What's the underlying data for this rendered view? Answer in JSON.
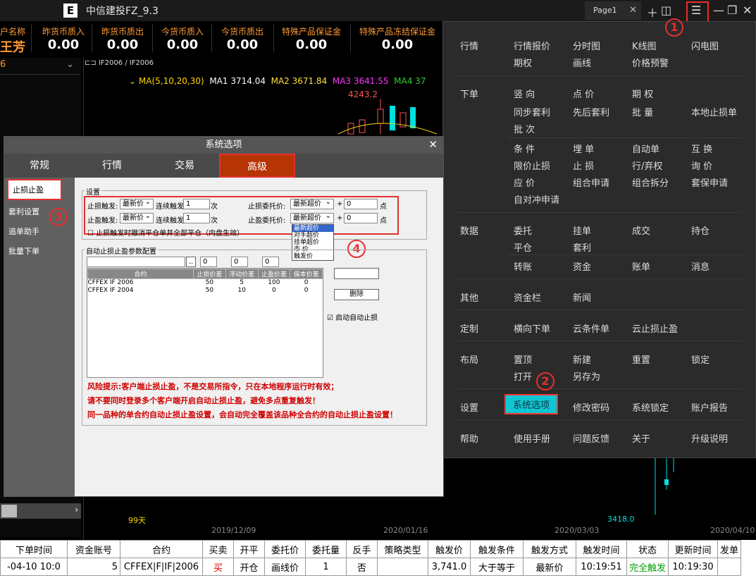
{
  "app": {
    "title": "中信建投FZ_9.3",
    "logo": "E",
    "page_tab": "Page1"
  },
  "titlebar_icons": [
    "add-icon",
    "layout-icon",
    "menu-icon",
    "minimize-icon",
    "restore-icon",
    "close-icon"
  ],
  "account_bar": {
    "columns": [
      {
        "label": "户名称",
        "value": "王芳"
      },
      {
        "label": "昨货币质入",
        "value": "0.00"
      },
      {
        "label": "昨货币质出",
        "value": "0.00"
      },
      {
        "label": "今货币质入",
        "value": "0.00"
      },
      {
        "label": "今货币质出",
        "value": "0.00"
      },
      {
        "label": "特殊产品保证金",
        "value": "0.00"
      },
      {
        "label": "特殊产品冻结保证金",
        "value": "0.00"
      }
    ]
  },
  "left_select": "6",
  "chart": {
    "contract_label": "IF2006 / IF2006",
    "ma_label": "MA(5,10,20,30)",
    "ma1": "MA1 3714.04",
    "ma2": "MA2 3671.84",
    "ma3": "MA3 3641.55",
    "ma4": "MA4 37",
    "high_label": "4243.2",
    "low_label": "3418.0",
    "period_label": "99天",
    "dates": [
      "2019/12/09",
      "2020/01/16",
      "2020/03/03",
      "2020/04/10"
    ]
  },
  "menu": {
    "sections": [
      {
        "cat": "行情",
        "items": [
          "行情报价",
          "分时图",
          "K线图",
          "闪电图",
          "期权",
          "画线",
          "价格预警"
        ]
      },
      {
        "cat": "下单",
        "items": [
          "竖 向",
          "点 价",
          "期 权",
          "同步套利",
          "先后套利",
          "批 量",
          "本地止损单",
          "批 次",
          "条 件",
          "埋 单",
          "自动单",
          "互 换",
          "限价止损",
          "止 损",
          "行/弃权",
          "询 价",
          "应 价",
          "组合申请",
          "组合拆分",
          "套保申请",
          "自对冲申请"
        ]
      },
      {
        "cat": "数据",
        "items": [
          "委托",
          "挂单",
          "成交",
          "持仓",
          "平仓",
          "套利",
          "转账",
          "资金",
          "账单",
          "消息"
        ]
      },
      {
        "cat": "其他",
        "items": [
          "资金栏",
          "新闻"
        ]
      },
      {
        "cat": "定制",
        "items": [
          "横向下单",
          "云条件单",
          "云止损止盈"
        ]
      },
      {
        "cat": "布局",
        "items": [
          "置顶",
          "新建",
          "重置",
          "锁定",
          "打开",
          "另存为"
        ]
      },
      {
        "cat": "设置",
        "items": [
          "系统选项",
          "修改密码",
          "系统锁定",
          "账户报告"
        ]
      },
      {
        "cat": "帮助",
        "items": [
          "使用手册",
          "问题反馈",
          "关于",
          "升级说明"
        ]
      }
    ]
  },
  "callouts": [
    "1",
    "2",
    "3",
    "4"
  ],
  "dialog": {
    "title": "系统选项",
    "tabs": [
      "常规",
      "行情",
      "交易",
      "高级"
    ],
    "side": [
      "止损止盈",
      "套利设置",
      "追单助手",
      "批量下单"
    ],
    "settings_group": "设置",
    "sl_trigger_label": "止损触发:",
    "tp_trigger_label": "止盈触发:",
    "trigger_price": "最新价",
    "consecutive_label": "连续触发",
    "consecutive_value": "1",
    "times_unit": "次",
    "sl_order_label": "止损委托价:",
    "tp_order_label": "止盈委托价:",
    "order_price": "最新超价",
    "plus": "+",
    "offset": "0",
    "tick_unit": "点",
    "cancel_check": "止损触发时撤消平仓单并全部平仓（内盘生效）",
    "auto_group": "自动止损止盈参数配置",
    "dropdown_options": [
      "最新超价",
      "对手超价",
      "挂单超价",
      "市 价",
      "触发价"
    ],
    "list_headers": [
      "合约",
      "止损价差",
      "浮动价差",
      "止盈价差",
      "保本价差"
    ],
    "list_rows": [
      [
        "CFFEX IF 2006",
        "50",
        "5",
        "100",
        "0"
      ],
      [
        "CFFEX IF 2004",
        "50",
        "10",
        "0",
        "0"
      ]
    ],
    "delete_btn": "删除",
    "enable_auto": "启动自动止损",
    "warn1": "风险提示:客户端止损止盈，不是交易所指令，只在本地程序运行时有效；",
    "warn2": "请不要同时登录多个客户端开启自动止损止盈，避免多点重复触发！",
    "warn3": "同一品种的单合约自动止损止盈设置，会自动完全覆盖该品种全合约的自动止损止盈设置！"
  },
  "bottom_table": {
    "headers": [
      "下单时间",
      "资金账号",
      "合约",
      "买卖",
      "开平",
      "委托价",
      "委托量",
      "反手",
      "策略类型",
      "触发价",
      "触发条件",
      "触发方式",
      "触发时间",
      "状态",
      "更新时间",
      "发单"
    ],
    "row": [
      "-04-10 10:0",
      "5",
      "CFFEX|F|IF|2006",
      "买",
      "开仓",
      "画线价",
      "1",
      "否",
      "",
      "3,741.0",
      "大于等于",
      "最新价",
      "10:19:51",
      "完全触发",
      "10:19:30",
      ""
    ]
  },
  "colors": {
    "menu_highlight": "#0fc7d4",
    "callout_red": "#e52f2f",
    "active_tab": "#b73405",
    "label_orange": "#ff9933"
  }
}
